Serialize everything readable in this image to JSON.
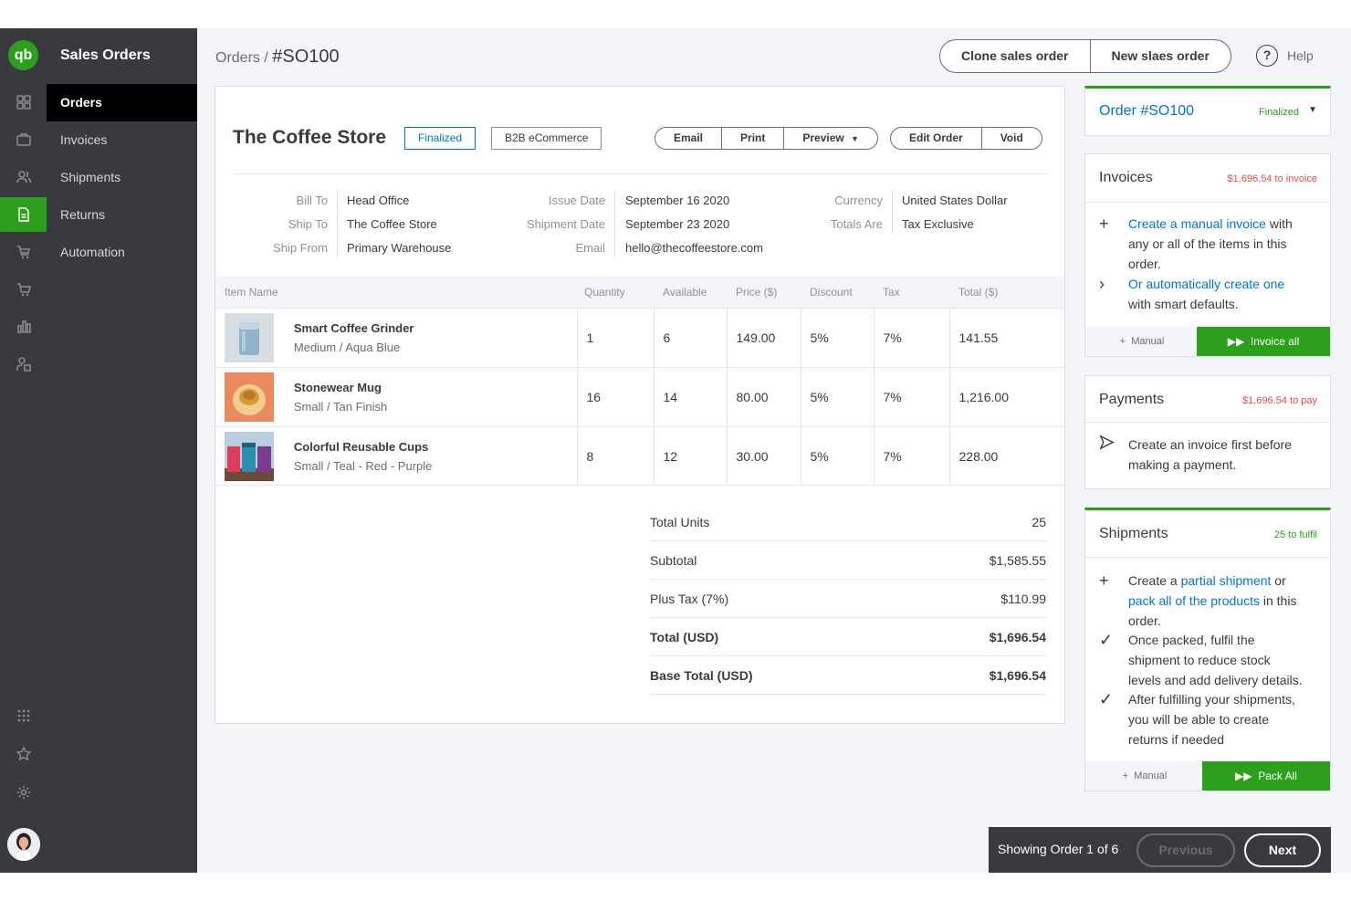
{
  "nav": {
    "title": "Sales Orders",
    "items": [
      {
        "label": "Orders"
      },
      {
        "label": "Invoices"
      },
      {
        "label": "Shipments"
      },
      {
        "label": "Returns"
      },
      {
        "label": "Automation"
      }
    ],
    "logo_text": "qb"
  },
  "header": {
    "breadcrumb_parent": "Orders /",
    "breadcrumb_current": "#SO100",
    "clone_label": "Clone sales order",
    "new_label": "New slaes order",
    "help_label": "Help"
  },
  "order": {
    "customer": "The Coffee Store",
    "status_badge": "Finalized",
    "channel_badge": "B2B eCommerce",
    "actions": {
      "email": "Email",
      "print": "Print",
      "preview": "Preview",
      "edit": "Edit Order",
      "void": "Void"
    },
    "meta": {
      "bill_to_label": "Bill To",
      "bill_to": "Head Office",
      "ship_to_label": "Ship To",
      "ship_to": "The Coffee Store",
      "ship_from_label": "Ship From",
      "ship_from": "Primary Warehouse",
      "issue_date_label": "Issue Date",
      "issue_date": "September 16 2020",
      "shipment_date_label": "Shipment Date",
      "shipment_date": "September 23 2020",
      "email_label": "Email",
      "email": "hello@thecoffeestore.com",
      "currency_label": "Currency",
      "currency": "United States Dollar",
      "totals_are_label": "Totals Are",
      "totals_are": "Tax Exclusive"
    },
    "columns": [
      "Item Name",
      "Quantity",
      "Available",
      "Price ($)",
      "Discount",
      "Tax",
      "Total ($)"
    ],
    "items": [
      {
        "name": "Smart Coffee Grinder",
        "variant": "Medium / Aqua Blue",
        "qty": "1",
        "available": "6",
        "price": "149.00",
        "discount": "5%",
        "tax": "7%",
        "total": "141.55"
      },
      {
        "name": "Stonewear Mug",
        "variant": "Small / Tan Finish",
        "qty": "16",
        "available": "14",
        "price": "80.00",
        "discount": "5%",
        "tax": "7%",
        "total": "1,216.00"
      },
      {
        "name": "Colorful Reusable Cups",
        "variant": "Small / Teal - Red - Purple",
        "qty": "8",
        "available": "12",
        "price": "30.00",
        "discount": "5%",
        "tax": "7%",
        "total": "228.00"
      }
    ],
    "totals": [
      {
        "label": "Total Units",
        "value": "25"
      },
      {
        "label": "Subtotal",
        "value": "$1,585.55"
      },
      {
        "label": "Plus Tax (7%)",
        "value": "$110.99"
      },
      {
        "label": "Total (USD)",
        "value": "$1,696.54"
      },
      {
        "label": "Base Total (USD)",
        "value": "$1,696.54"
      }
    ]
  },
  "sidebar": {
    "order_title": "Order #SO100",
    "order_status": "Finalized",
    "invoices": {
      "title": "Invoices",
      "aux": "$1,696.54 to invoice",
      "link1": "Create a manual invoice",
      "text1a": " with",
      "text1b": "any or all of the items in this",
      "text1c": "order.",
      "link2": "Or automatically create one",
      "text2": "with smart defaults.",
      "manual": "Manual",
      "action": "Invoice all"
    },
    "payments": {
      "title": "Payments",
      "aux": "$1,696.54 to pay",
      "text1": "Create an invoice first before",
      "text2": "making a payment."
    },
    "shipments": {
      "title": "Shipments",
      "aux": "25 to fulfil",
      "l1a": "Create a ",
      "l1link": "partial shipment",
      "l1b": " or",
      "l2link": "pack all of the products",
      "l2b": " in this",
      "l3": "order.",
      "p2a": "Once packed, fulfil the",
      "p2b": "shipment to reduce stock",
      "p2c": "levels and add delivery details.",
      "p3a": "After fulfilling your shipments,",
      "p3b": "you will be able to create",
      "p3c": "returns if needed",
      "manual": "Manual",
      "action": "Pack All"
    }
  },
  "pager": {
    "label": "Showing Order 1 of 6",
    "previous": "Previous",
    "next": "Next"
  },
  "colors": {
    "brand_green": "#2ca01c",
    "link_blue": "#0077c5",
    "alert_red": "#e44c4c",
    "dark": "#393a3d"
  }
}
